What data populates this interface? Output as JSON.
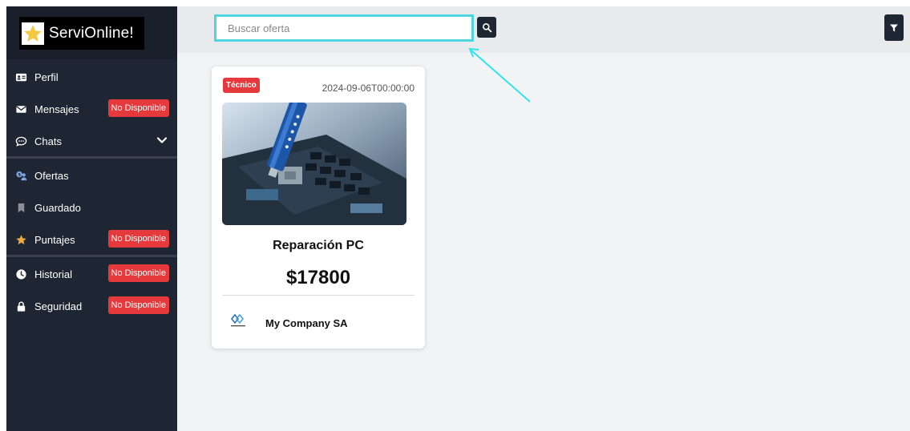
{
  "brand": {
    "name": "ServiOnline!"
  },
  "sidebar": {
    "items": [
      {
        "label": "Perfil",
        "icon": "id-card-icon"
      },
      {
        "label": "Mensajes",
        "icon": "envelope-icon",
        "badge": "No Disponible"
      },
      {
        "label": "Chats",
        "icon": "chat-icon"
      },
      {
        "label": "Ofertas",
        "icon": "offers-icon"
      },
      {
        "label": "Guardado",
        "icon": "bookmark-icon"
      },
      {
        "label": "Puntajes",
        "icon": "star-icon",
        "badge": "No Disponible"
      },
      {
        "label": "Historial",
        "icon": "clock-icon",
        "badge": "No Disponible"
      },
      {
        "label": "Seguridad",
        "icon": "lock-icon",
        "badge": "No Disponible"
      }
    ]
  },
  "search": {
    "placeholder": "Buscar oferta",
    "value": ""
  },
  "offer": {
    "tag": "Técnico",
    "date": "2024-09-06T00:00:00",
    "title": "Reparación PC",
    "price": "$17800",
    "company": "My Company SA"
  },
  "colors": {
    "sidebar": "#1f2633",
    "badge": "#e5393b",
    "highlight": "#4dd6e0",
    "main_bg": "#f2f3f5"
  }
}
